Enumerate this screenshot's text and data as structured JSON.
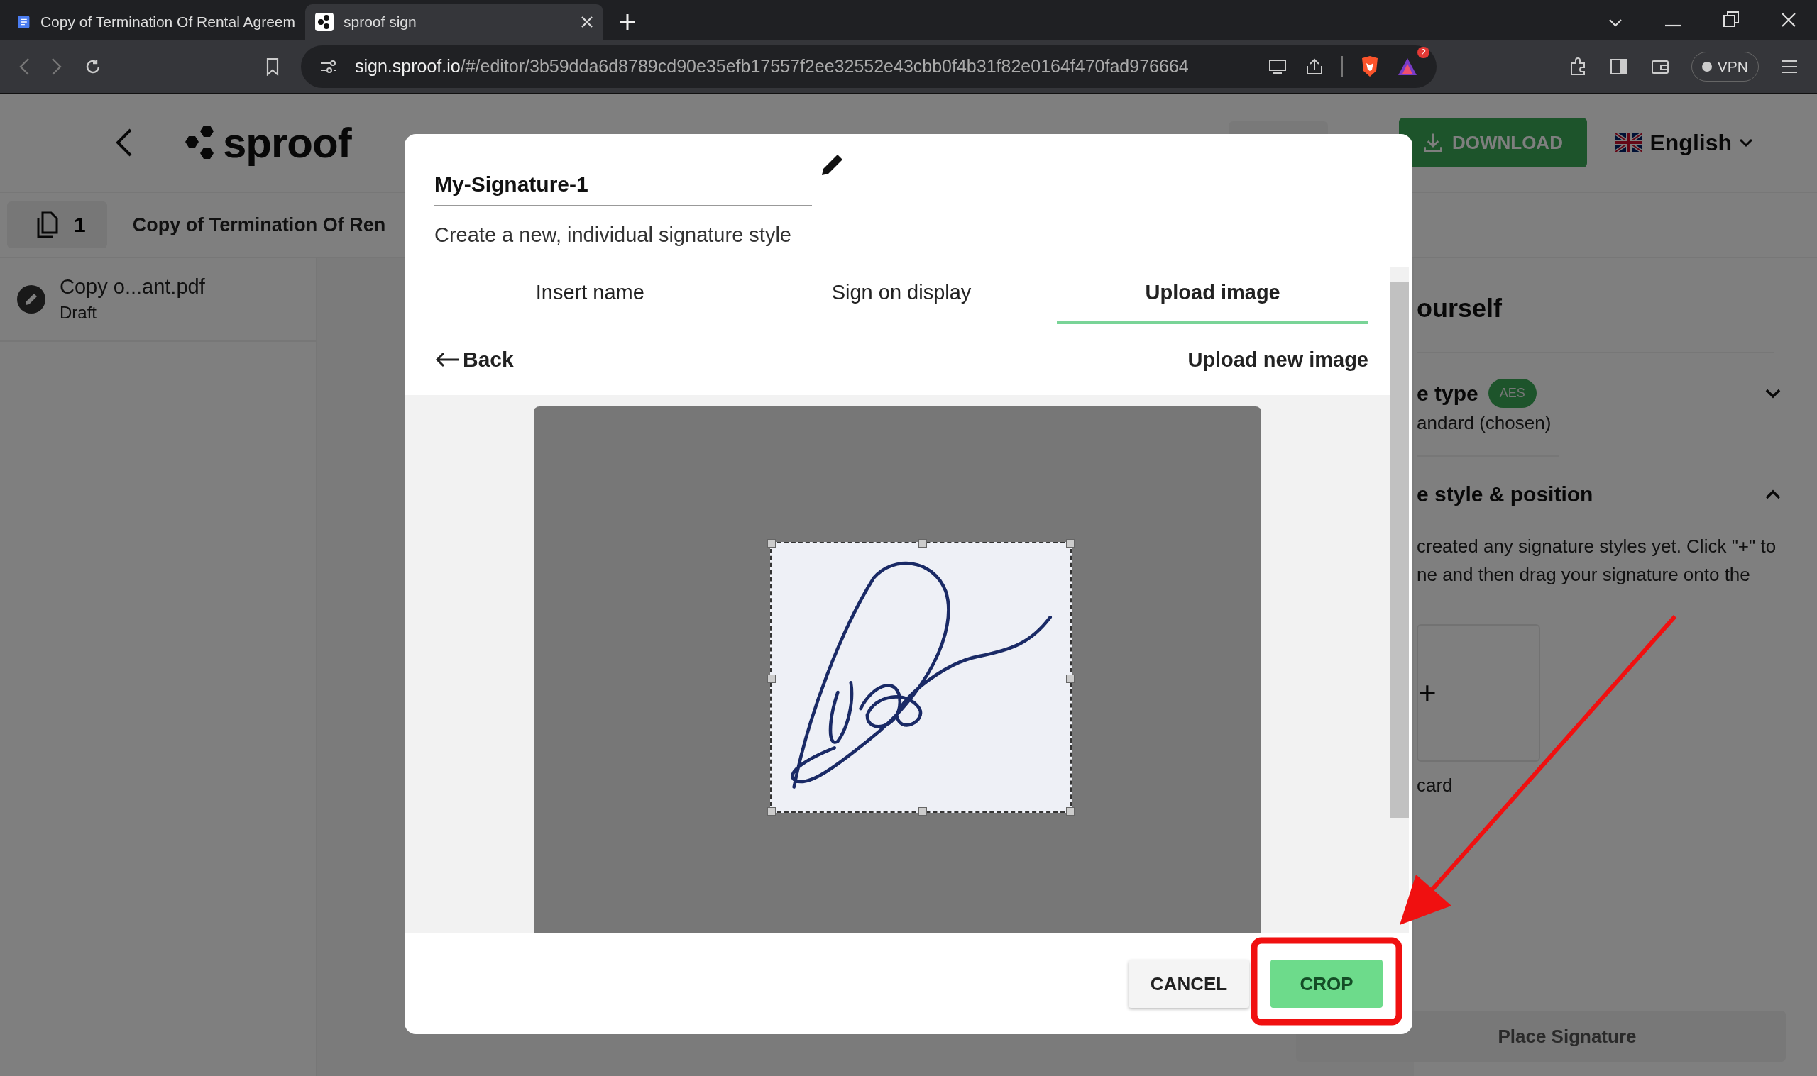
{
  "browser": {
    "tabs": [
      {
        "title": "Copy of Termination Of Rental Agreem",
        "selected": false
      },
      {
        "title": "sproof sign",
        "selected": true
      }
    ],
    "url_host": "sign.sproof.io",
    "url_path": "/#/editor/3b59dda6d8789cd90e35efb17557f2ee32552e43cbb0f4b31f82e0164f470fad976664",
    "notification_count": "2",
    "vpn_label": "VPN"
  },
  "app": {
    "logo": "sproof",
    "download_label": "DOWNLOAD",
    "language": "English",
    "page_count": "1",
    "document_title": "Copy of Termination Of Ren",
    "sidebar": {
      "items": [
        {
          "name": "Copy o...ant.pdf",
          "status": "Draft"
        }
      ]
    },
    "right_panel": {
      "heading": "ourself",
      "sections": [
        {
          "title": "e type",
          "badge": "AES",
          "subtitle": "andard (chosen)",
          "expanded": false
        },
        {
          "title": "e style & position",
          "expanded": true,
          "text_lines": [
            "created any signature styles yet. Click \"+\" to",
            "ne and then drag your signature onto the"
          ],
          "card_symbol": "+",
          "card_label": "card"
        }
      ],
      "place_button": "Place Signature"
    }
  },
  "dialog": {
    "name_value": "My-Signature-1",
    "subtitle": "Create a new, individual signature style",
    "tabs": [
      {
        "label": "Insert name",
        "selected": false
      },
      {
        "label": "Sign on display",
        "selected": false
      },
      {
        "label": "Upload image",
        "selected": true
      }
    ],
    "back_label": "Back",
    "upload_label": "Upload new image",
    "buttons": [
      {
        "label": "CANCEL",
        "kind": "secondary"
      },
      {
        "label": "CROP",
        "kind": "primary"
      }
    ]
  },
  "annotations": {
    "arrow": true,
    "highlight_box": true
  }
}
